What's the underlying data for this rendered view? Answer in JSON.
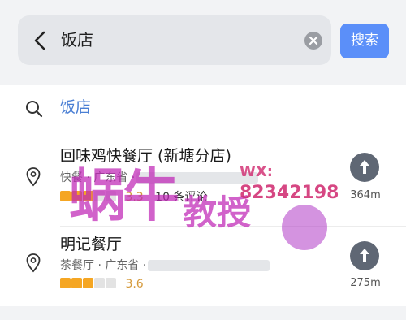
{
  "search": {
    "query": "饭店",
    "button_label": "搜索"
  },
  "suggestion": {
    "text": "饭店"
  },
  "results": [
    {
      "title": "回味鸡快餐厅 (新塘分店)",
      "subtitle": "快餐 · 广东省 ·",
      "rating": "3.3",
      "stars_filled": 3,
      "reviews": "10 条评论",
      "distance": "364m"
    },
    {
      "title": "明记餐厅",
      "subtitle": "茶餐厅 · 广东省 ·",
      "rating": "3.6",
      "stars_filled": 3,
      "reviews": "",
      "distance": "275m"
    }
  ],
  "watermark": {
    "main": "蜗牛",
    "sub": "教授",
    "wx": "WX:",
    "number": "82342198"
  },
  "colors": {
    "accent": "#5b8ff9",
    "suggestion_text": "#4a7fd4",
    "rating": "#d59a3b",
    "watermark": "#c026b7"
  },
  "icons": [
    "back-icon",
    "clear-icon",
    "search-icon",
    "location-pin-icon",
    "navigate-icon"
  ]
}
